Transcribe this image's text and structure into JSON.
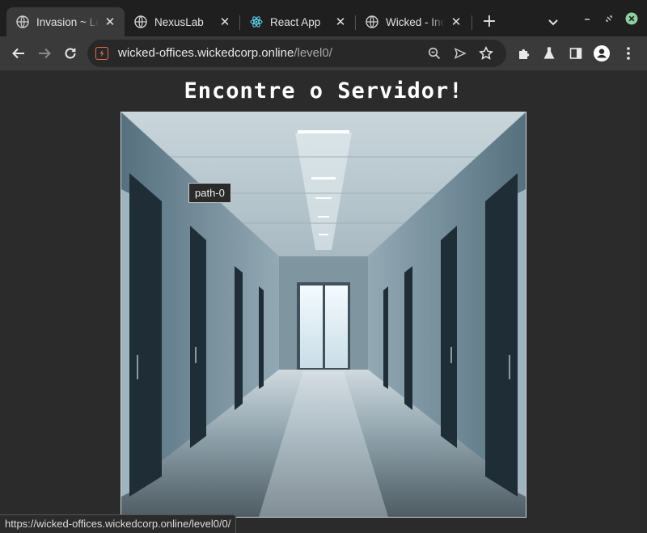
{
  "browser": {
    "tabs": [
      {
        "title": "Invasion ~ Le",
        "icon": "globe-icon",
        "active": true
      },
      {
        "title": "NexusLab",
        "icon": "globe-icon",
        "active": false
      },
      {
        "title": "React App",
        "icon": "react-icon",
        "active": false
      },
      {
        "title": "Wicked - Inov",
        "icon": "globe-icon",
        "active": false
      }
    ],
    "url_host": "wicked-offices.wickedcorp.online",
    "url_path": "/level0/",
    "accent_close_color": "#8fd19e"
  },
  "page": {
    "heading": "Encontre o Servidor!",
    "tooltip": "path-0",
    "scene_description_icon": "office-corridor-image"
  },
  "status": {
    "hover_url": "https://wicked-offices.wickedcorp.online/level0/0/"
  }
}
